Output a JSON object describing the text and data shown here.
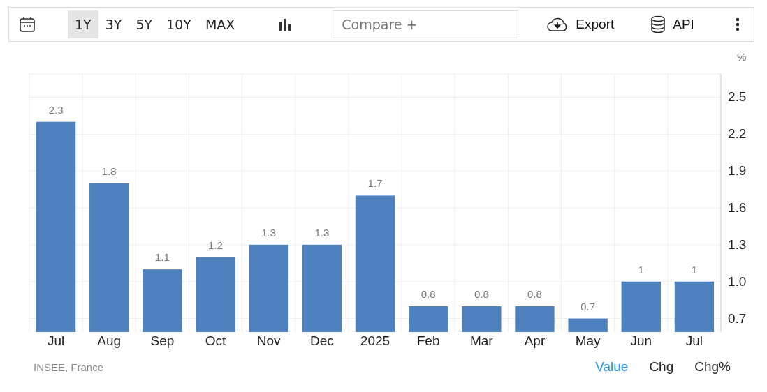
{
  "toolbar": {
    "ranges": [
      {
        "label": "1Y",
        "selected": true
      },
      {
        "label": "3Y",
        "selected": false
      },
      {
        "label": "5Y",
        "selected": false
      },
      {
        "label": "10Y",
        "selected": false
      },
      {
        "label": "MAX",
        "selected": false
      }
    ],
    "compare": {
      "placeholder": "Compare +"
    },
    "export": "Export",
    "api": "API"
  },
  "chart": {
    "unit": "%",
    "chart_data": {
      "type": "bar",
      "categories": [
        "Jul",
        "Aug",
        "Sep",
        "Oct",
        "Nov",
        "Dec",
        "2025",
        "Feb",
        "Mar",
        "Apr",
        "May",
        "Jun",
        "Jul"
      ],
      "series": [
        {
          "color": "#4e81bd",
          "values": [
            2.3,
            1.8,
            1.1,
            1.2,
            1.3,
            1.3,
            1.7,
            0.8,
            0.8,
            0.8,
            0.7,
            1,
            1
          ]
        }
      ],
      "ylim": [
        0.59,
        2.69
      ],
      "yticks": [
        {
          "value": 0.7,
          "label": "0.7"
        },
        {
          "value": 1,
          "label": "1.0"
        },
        {
          "value": 1.3,
          "label": "1.3"
        },
        {
          "value": 1.6,
          "label": "1.6"
        },
        {
          "value": 1.9,
          "label": "1.9"
        },
        {
          "value": 2.2,
          "label": "2.2"
        },
        {
          "value": 2.5,
          "label": "2.5"
        }
      ],
      "data_labels": true,
      "grid": true
    }
  },
  "footer": {
    "source": "INSEE, France",
    "modes": [
      {
        "label": "Value",
        "selected": true
      },
      {
        "label": "Chg",
        "selected": false
      },
      {
        "label": "Chg%",
        "selected": false
      }
    ]
  }
}
